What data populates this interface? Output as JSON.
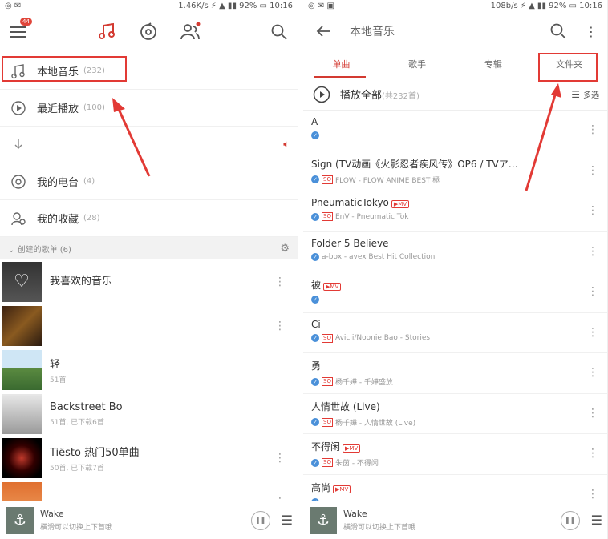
{
  "left": {
    "status": {
      "net": "1.46K/s",
      "battery": "92%",
      "time": "10:16"
    },
    "badge": "44",
    "menu": [
      {
        "label": "本地音乐",
        "count": "(232)"
      },
      {
        "label": "最近播放",
        "count": "(100)"
      },
      {
        "label": "",
        "count": ""
      },
      {
        "label": "我的电台",
        "count": "(4)"
      },
      {
        "label": "我的收藏",
        "count": "(28)"
      }
    ],
    "section": "创建的歌单 (6)",
    "playlists": [
      {
        "title": "我喜欢的音乐",
        "sub": ""
      },
      {
        "title": "",
        "sub": ""
      },
      {
        "title": "轻",
        "sub": "51首"
      },
      {
        "title": "Backstreet Bo",
        "sub": "51首, 已下载6首"
      },
      {
        "title": "Tiësto 热门50单曲",
        "sub": "50首, 已下载7首"
      }
    ],
    "player": {
      "title": "Wake",
      "sub": "横滑可以切换上下首哦"
    }
  },
  "right": {
    "status": {
      "net": "108b/s",
      "battery": "92%",
      "time": "10:16"
    },
    "title": "本地音乐",
    "tabs": [
      "单曲",
      "歌手",
      "专辑",
      "文件夹"
    ],
    "play_all": "播放全部",
    "play_all_count": "(共232首)",
    "multi": "多选",
    "songs": [
      {
        "title": "A",
        "sub": "",
        "sq": false,
        "mv": false
      },
      {
        "title": "Sign (TV动画《火影忍者疾风传》OP6 / TVア…",
        "sub": "FLOW - FLOW ANIME BEST 極",
        "sq": true,
        "mv": false
      },
      {
        "title": "PneumaticTokyo",
        "sub": "EnV - Pneumatic Tok",
        "sq": true,
        "mv": true
      },
      {
        "title": "Folder 5  Believe",
        "sub": "a-box - avex Best Hit Collection",
        "sq": false,
        "mv": false
      },
      {
        "title": "被",
        "sub": "",
        "sq": false,
        "mv": true
      },
      {
        "title": "Ci",
        "sub": "Avicii/Noonie Bao - Stories",
        "sq": true,
        "mv": false
      },
      {
        "title": "勇",
        "sub": "杨千嬅 - 千嬅盛放",
        "sq": true,
        "mv": false
      },
      {
        "title": "人情世故 (Live)",
        "sub": "杨千嬅 - 人情世故 (Live)",
        "sq": true,
        "mv": false
      },
      {
        "title": "不得闲",
        "sub": "朱茵 - 不得闲",
        "sq": true,
        "mv": true
      },
      {
        "title": "高尚",
        "sub": "",
        "sq": false,
        "mv": true
      }
    ],
    "mv_label": "MV",
    "sq_label": "SQ",
    "player": {
      "title": "Wake",
      "sub": "横滑可以切换上下首哦"
    }
  },
  "colors": {
    "accent": "#d33a31",
    "highlight": "#e23a35",
    "check": "#4a90d9"
  }
}
